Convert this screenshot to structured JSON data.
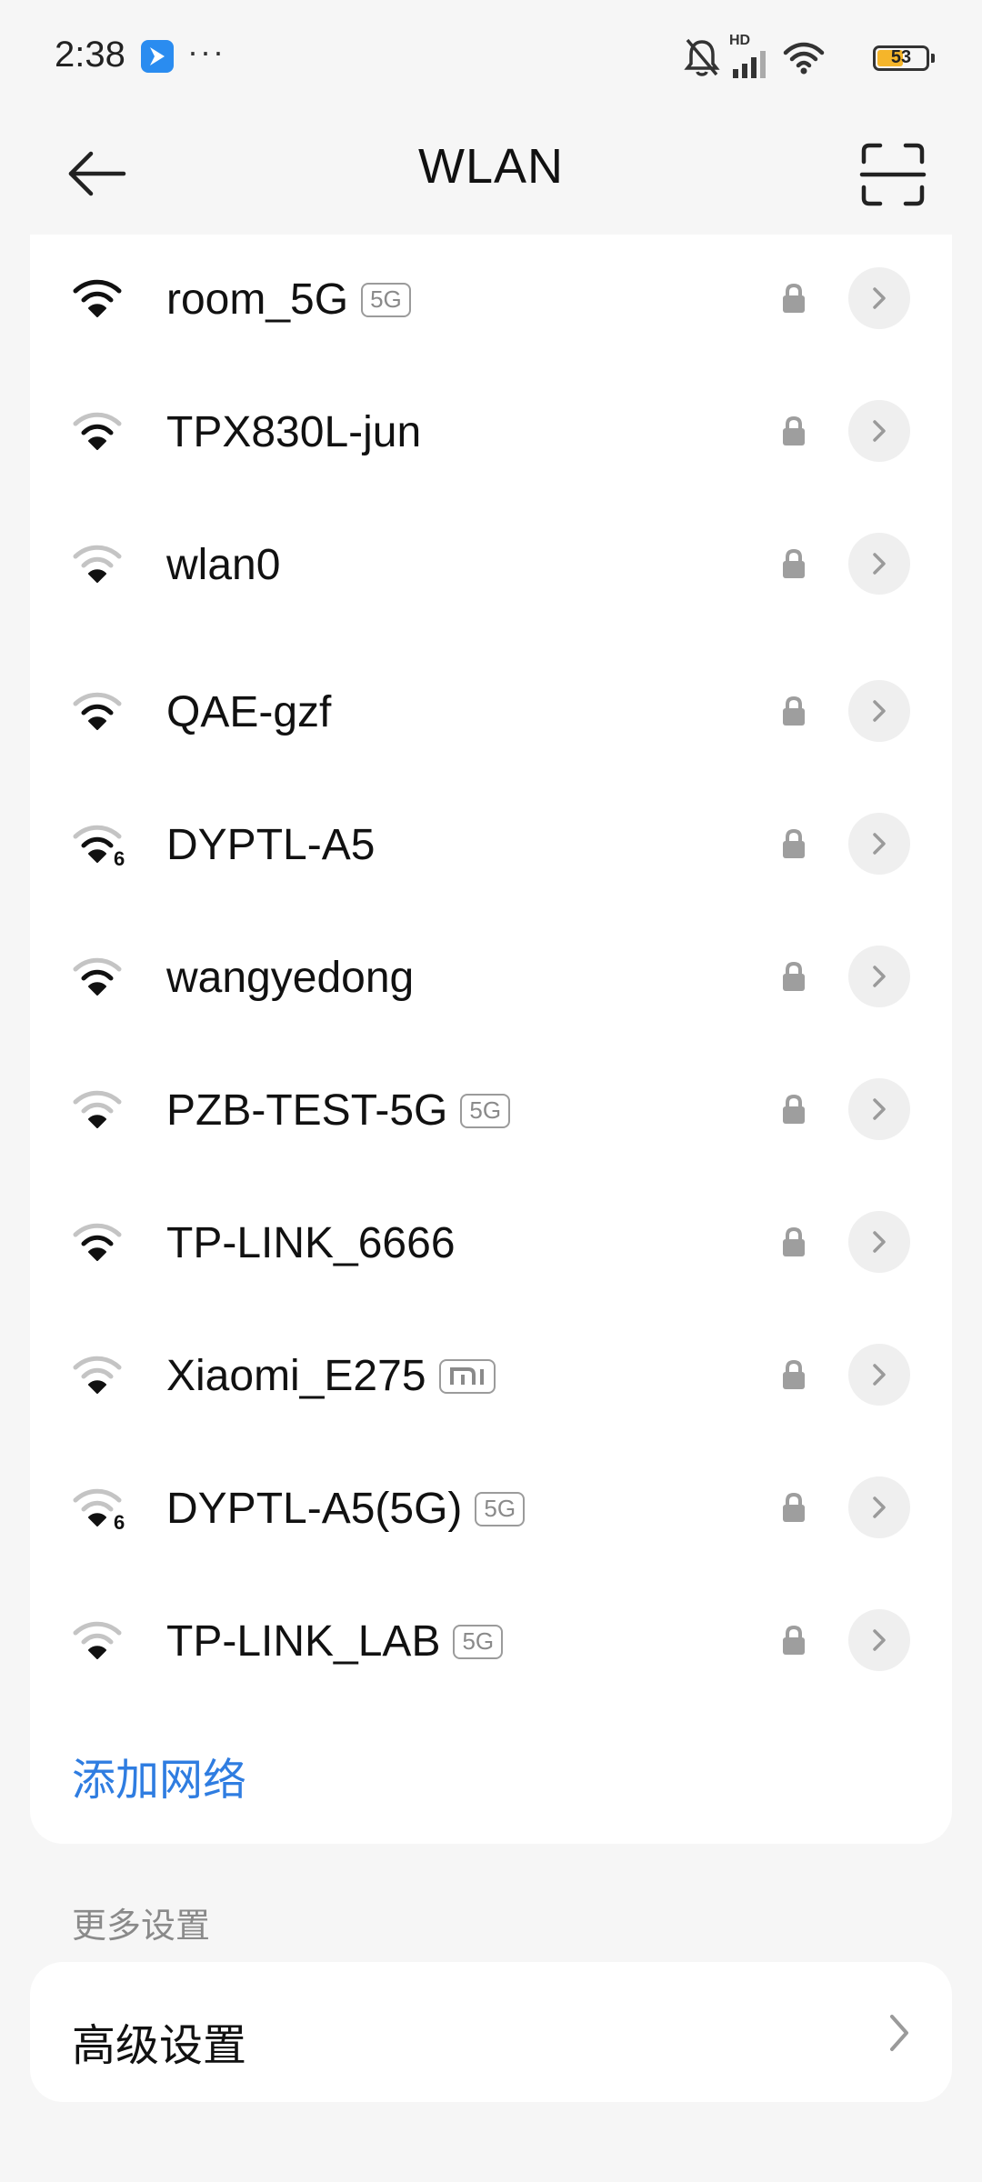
{
  "status_bar": {
    "time": "2:38",
    "dots": "···",
    "hd_label": "HD",
    "battery_level": "53",
    "battery_fraction": 0.53
  },
  "header": {
    "title": "WLAN"
  },
  "networks": [
    {
      "name": "room_5G",
      "badge": "5G",
      "wifi6": false,
      "signal": 3,
      "locked": true
    },
    {
      "name": "TPX830L-jun",
      "badge": "",
      "wifi6": false,
      "signal": 2,
      "locked": true
    },
    {
      "name": "wlan0",
      "badge": "",
      "wifi6": false,
      "signal": 1,
      "locked": true
    },
    {
      "name": "QAE-gzf",
      "badge": "",
      "wifi6": false,
      "signal": 2,
      "locked": true
    },
    {
      "name": "DYPTL-A5",
      "badge": "",
      "wifi6": true,
      "wifi6_label": "6",
      "signal": 2,
      "locked": true
    },
    {
      "name": "wangyedong",
      "badge": "",
      "wifi6": false,
      "signal": 2,
      "locked": true
    },
    {
      "name": "PZB-TEST-5G",
      "badge": "5G",
      "wifi6": false,
      "signal": 1,
      "locked": true
    },
    {
      "name": "TP-LINK_6666",
      "badge": "",
      "wifi6": false,
      "signal": 2,
      "locked": true
    },
    {
      "name": "Xiaomi_E275",
      "badge": "",
      "mi_badge": true,
      "wifi6": false,
      "signal": 0,
      "locked": true
    },
    {
      "name": "DYPTL-A5(5G)",
      "badge": "5G",
      "wifi6": true,
      "wifi6_label": "6",
      "signal": 0,
      "locked": true
    },
    {
      "name": "TP-LINK_LAB",
      "badge": "5G",
      "wifi6": false,
      "signal": 0,
      "locked": true
    }
  ],
  "add_network_label": "添加网络",
  "more_settings_header": "更多设置",
  "advanced_settings_label": "高级设置",
  "colors": {
    "accent": "#2f7de1",
    "background": "#f6f6f6",
    "card": "#ffffff",
    "battery": "#f5b52a"
  },
  "icons": {
    "back": "arrow-left-icon",
    "scan": "scan-icon",
    "wifi": "wifi-icon",
    "lock": "lock-icon",
    "chevron": "chevron-right-icon"
  }
}
